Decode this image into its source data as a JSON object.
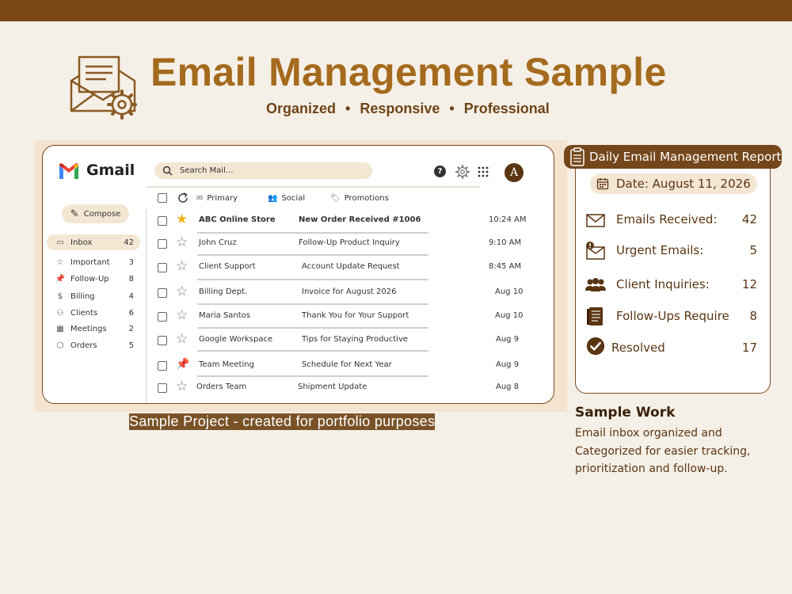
{
  "header": {
    "title": "Email Management Sample",
    "tagline": [
      "Organized",
      "Responsive",
      "Professional"
    ],
    "separator": "•"
  },
  "gmail": {
    "app_name": "Gmail",
    "search": {
      "placeholder": "Search Mail..."
    },
    "avatar_letter": "A",
    "compose_label": "Compose",
    "sidebar": [
      {
        "icon": "inbox-icon",
        "label": "Inbox",
        "count": "42",
        "active": true
      },
      {
        "icon": "star-icon",
        "label": "Important",
        "count": "3"
      },
      {
        "icon": "pin-icon",
        "label": "Follow-Up",
        "count": "8"
      },
      {
        "icon": "dollar-icon",
        "label": "Billing",
        "count": "4"
      },
      {
        "icon": "people-icon",
        "label": "Clients",
        "count": "6"
      },
      {
        "icon": "calendar-icon",
        "label": "Meetings",
        "count": "2"
      },
      {
        "icon": "box-icon",
        "label": "Orders",
        "count": "5"
      }
    ],
    "tabs": [
      {
        "icon": "mail-icon",
        "label": "Primary"
      },
      {
        "icon": "people-icon",
        "label": "Social"
      },
      {
        "icon": "tag-icon",
        "label": "Promotions"
      }
    ],
    "emails": [
      {
        "sender": "ABC Online Store",
        "subject": "New Order Received #1006",
        "time": "10:24 AM",
        "marker": "star-filled",
        "bold": true
      },
      {
        "sender": "John Cruz",
        "subject": "Follow-Up Product Inquiry",
        "time": "9:10 AM",
        "marker": "star"
      },
      {
        "sender": "Client Support",
        "subject": "Account Update  Request",
        "time": "8:45 AM",
        "marker": "star"
      },
      {
        "sender": "Billing Dept.",
        "subject": "Invoice for August 2026",
        "time": "Aug 10",
        "marker": "star"
      },
      {
        "sender": "Maria Santos",
        "subject": "Thank You for Your Support",
        "time": "Aug 10",
        "marker": "star"
      },
      {
        "sender": "Google Workspace",
        "subject": "Tips for Staying Productive",
        "time": "Aug 9",
        "marker": "star"
      },
      {
        "sender": "Team Meeting",
        "subject": "Schedule for Next Year",
        "time": "Aug 9",
        "marker": "pin"
      },
      {
        "sender": "Orders Team",
        "subject": "Shipment Update",
        "time": "Aug 8",
        "marker": "star"
      }
    ]
  },
  "caption": "Sample Project - created for portfolio purposes",
  "report": {
    "title": "Daily Email Management Report",
    "date": "Date: August 11, 2026",
    "stats": [
      {
        "icon": "envelope-icon",
        "label": "Emails Received:",
        "value": "42"
      },
      {
        "icon": "urgent-mail-icon",
        "label": "Urgent Emails:",
        "value": "5"
      },
      {
        "icon": "clients-icon",
        "label": "Client Inquiries:",
        "value": "12"
      },
      {
        "icon": "document-icon",
        "label": "Follow-Ups Require",
        "value": "8"
      },
      {
        "icon": "checkmark-icon",
        "label": "Resolved",
        "value": "17"
      }
    ]
  },
  "sample_work": {
    "title": "Sample Work",
    "lines": [
      "Email inbox organized and",
      "Categorized for easier tracking,",
      "prioritization and follow-up."
    ]
  },
  "colors": {
    "brand_brown": "#7a4616",
    "title_gold": "#a46a1d",
    "accent_beige": "#f3e6d3",
    "background": "#f5f0e7",
    "star_yellow": "#f2b318"
  }
}
